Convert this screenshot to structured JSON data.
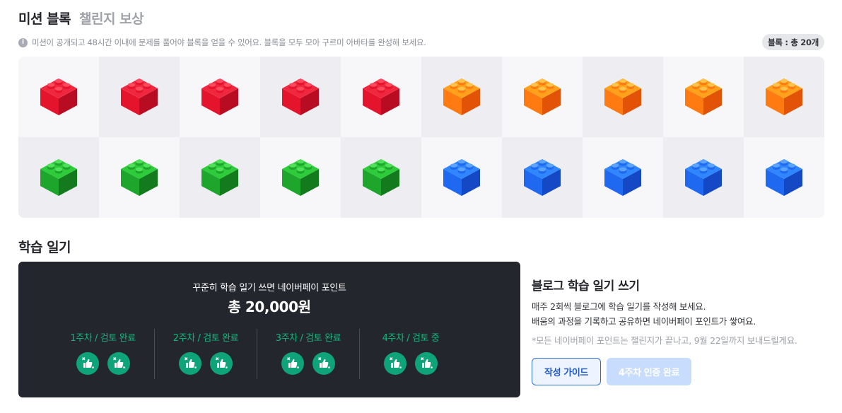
{
  "tabs": [
    {
      "label": "미션 블록",
      "active": true
    },
    {
      "label": "챌린지 보상",
      "active": false
    }
  ],
  "info": {
    "icon": "info-icon",
    "text": "미션이 공개되고 48시간 이내에 문제를 풀어야 블록을 얻을 수 있어요. 블록을 모두 모아 구르미 아바타를 완성해 보세요.",
    "count_badge": "블록 : 총 20개"
  },
  "blocks": {
    "colors": {
      "red": {
        "top": "#f0283f",
        "left": "#e5142d",
        "right": "#b80c22",
        "stud": "#ff4a5d"
      },
      "orange": {
        "top": "#ffa11a",
        "left": "#ff7a10",
        "right": "#e25308",
        "stud": "#ffc24a"
      },
      "green": {
        "top": "#2ecb3a",
        "left": "#1ea52c",
        "right": "#137a1e",
        "stud": "#4fe05a"
      },
      "blue": {
        "top": "#2f86ff",
        "left": "#1f68f0",
        "right": "#1448c4",
        "stud": "#5aa4ff"
      }
    },
    "rows": [
      [
        "red",
        "red",
        "red",
        "red",
        "red",
        "orange",
        "orange",
        "orange",
        "orange",
        "orange"
      ],
      [
        "green",
        "green",
        "green",
        "green",
        "green",
        "blue",
        "blue",
        "blue",
        "blue",
        "blue"
      ]
    ]
  },
  "diary": {
    "title": "학습 일기",
    "card": {
      "subtitle": "꾸준히 학습 일기 쓰면 네이버페이 포인트",
      "amount": "총 20,000원",
      "weeks": [
        {
          "label": "1주차 / 검토 완료",
          "icons": [
            "thumbs-up-icon",
            "thumbs-up-icon"
          ]
        },
        {
          "label": "2주차 / 검토 완료",
          "icons": [
            "thumbs-up-icon",
            "thumbs-up-icon"
          ]
        },
        {
          "label": "3주차 / 검토 완료",
          "icons": [
            "thumbs-up-icon",
            "thumbs-up-icon"
          ]
        },
        {
          "label": "4주차 / 검토 중",
          "icons": [
            "thumbs-up-icon",
            "thumbs-up-icon"
          ]
        }
      ]
    },
    "side": {
      "title": "블로그 학습 일기 쓰기",
      "desc_line1": "매주 2회씩 블로그에 학습 일기를 작성해 보세요.",
      "desc_line2": "배움의 과정을 기록하고 공유하면 네이버페이 포인트가 쌓여요.",
      "note": "*모든 네이버페이 포인트는 챌린지가 끝나고, 9월 22일까지 보내드릴게요.",
      "guide_button": "작성 가이드",
      "done_button": "4주차 인증 완료"
    }
  }
}
